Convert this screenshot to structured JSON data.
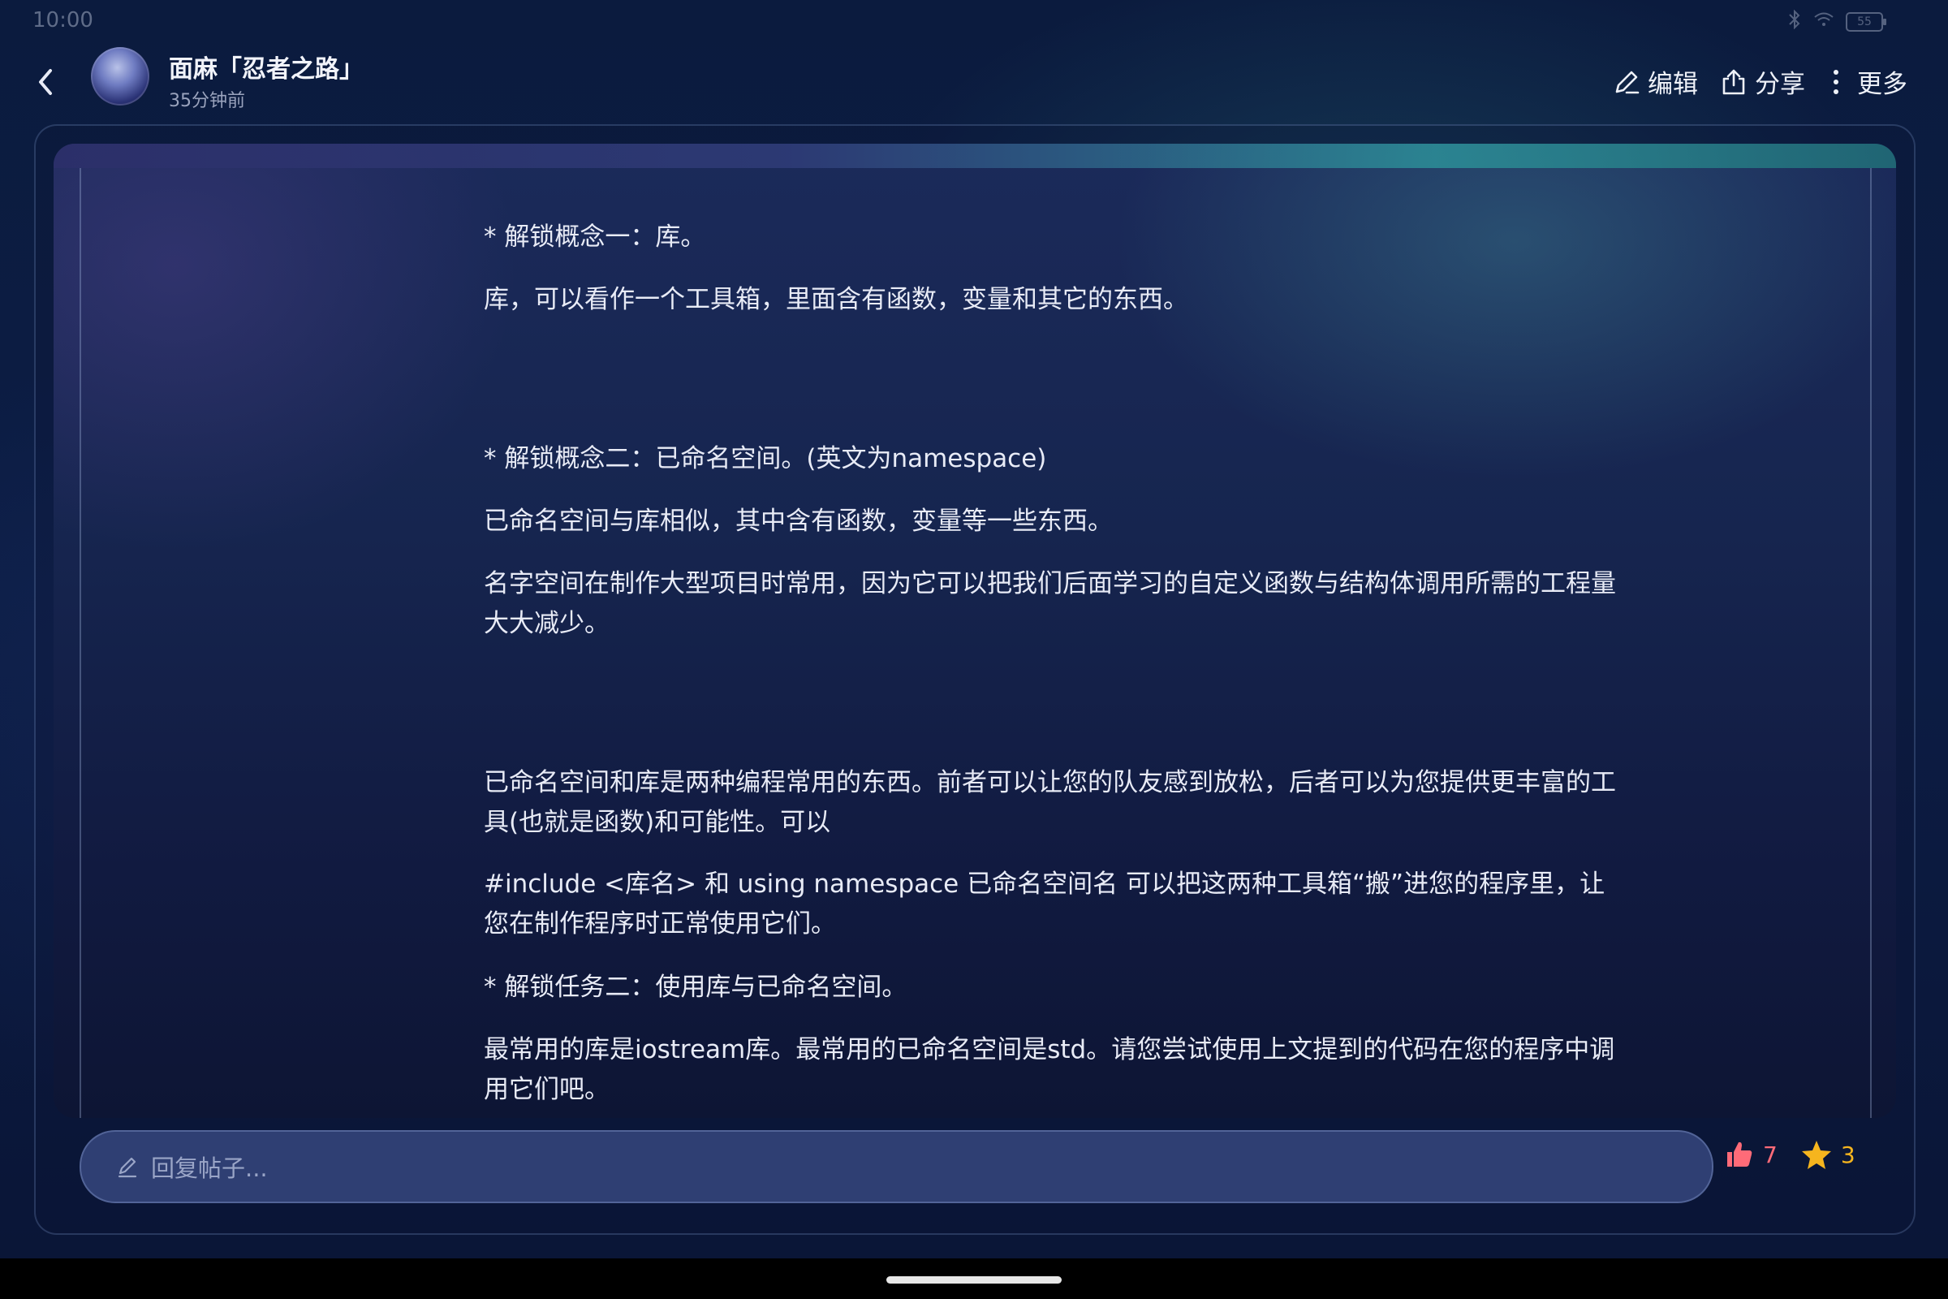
{
  "status_bar": {
    "time": "10:00",
    "battery": "55"
  },
  "header": {
    "author_name": "面麻「忍者之路」",
    "post_time": "35分钟前",
    "actions": {
      "edit": "编辑",
      "share": "分享",
      "more": "更多"
    }
  },
  "post": {
    "paragraphs": [
      "* 解锁概念一：库。",
      "库，可以看作一个工具箱，里面含有函数，变量和其它的东西。",
      "* 解锁概念二：已命名空间。(英文为namespace)",
      "已命名空间与库相似，其中含有函数，变量等一些东西。",
      "名字空间在制作大型项目时常用，因为它可以把我们后面学习的自定义函数与结构体调用所需的工程量大大减少。",
      "已命名空间和库是两种编程常用的东西。前者可以让您的队友感到放松，后者可以为您提供更丰富的工具(也就是函数)和可能性。可以",
      "#include <库名> 和 using namespace 已命名空间名 可以把这两种工具箱“搬”进您的程序里，让您在制作程序时正常使用它们。",
      "* 解锁任务二：使用库与已命名空间。",
      "最常用的库是iostream库。最常用的已命名空间是std。请您尝试使用上文提到的代码在您的程序中调用它们吧。"
    ]
  },
  "reply": {
    "placeholder": "回复帖子..."
  },
  "reactions": {
    "likes": "7",
    "favorites": "3"
  },
  "colors": {
    "like": "#ff6b78",
    "favorite": "#f6b51e",
    "accent_teal": "#2c8f98"
  }
}
